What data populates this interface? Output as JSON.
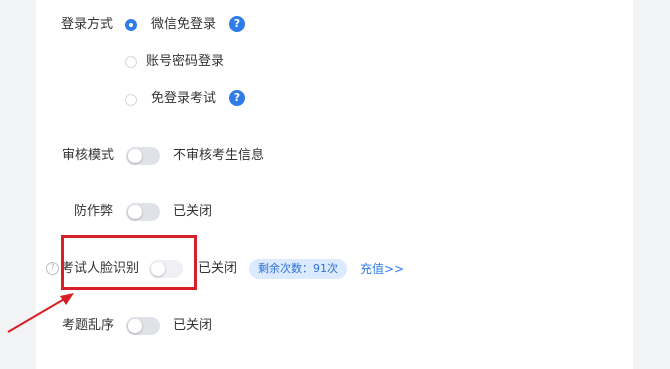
{
  "login": {
    "label": "登录方式",
    "options": [
      {
        "label": "微信免登录",
        "checked": true
      },
      {
        "label": "账号密码登录",
        "checked": false
      },
      {
        "label": "免登录考试",
        "checked": false
      }
    ]
  },
  "review": {
    "label": "审核模式",
    "state": "不审核考生信息",
    "on": false
  },
  "anticheat": {
    "label": "防作弊",
    "state": "已关闭",
    "on": false
  },
  "face": {
    "label": "考试人脸识别",
    "state": "已关闭",
    "on": false,
    "remaining": "剩余次数：91次",
    "recharge": "充值>>"
  },
  "shuffle": {
    "label": "考题乱序",
    "state": "已关闭",
    "on": false
  },
  "icons": {
    "help": "?",
    "info": "?"
  },
  "colors": {
    "accent": "#2f7ce8",
    "highlight": "#d61f26"
  }
}
